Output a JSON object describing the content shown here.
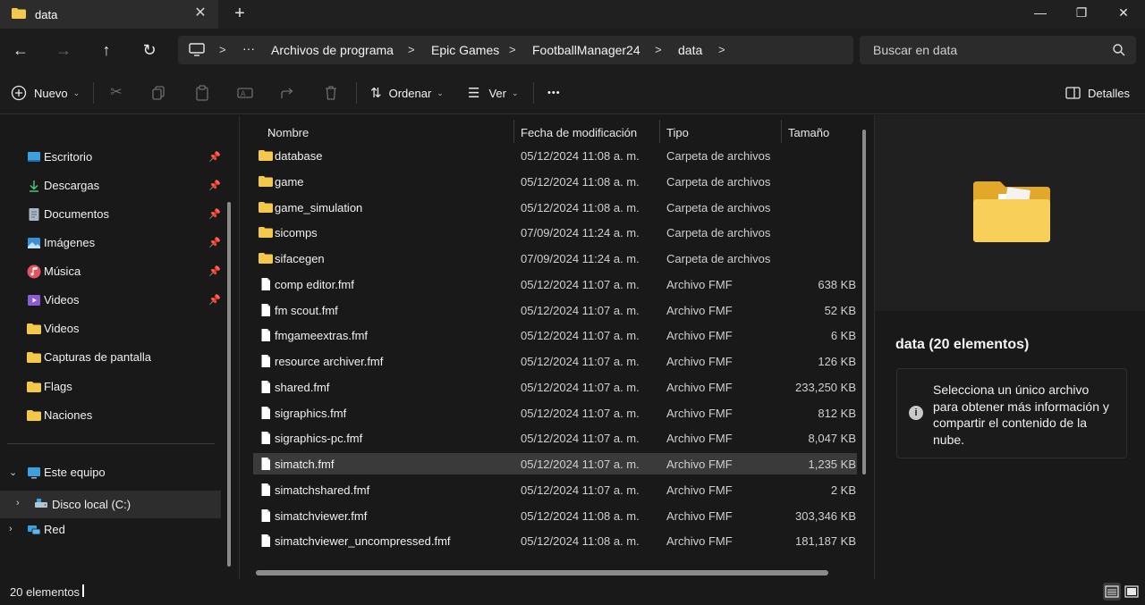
{
  "window": {
    "tab_title": "data",
    "icons": {
      "tab": "folder-icon",
      "close": "close-icon",
      "new_tab": "plus-icon"
    },
    "controls": {
      "minimize": "—",
      "maximize": "❐",
      "close": "✕"
    }
  },
  "navigation": {
    "back": "←",
    "forward": "→",
    "up": "↑",
    "refresh": "↻",
    "breadcrumb": [
      "Archivos de programa",
      "Epic Games",
      "FootballManager24",
      "data"
    ],
    "ellipsis": "···",
    "search_placeholder": "Buscar en data"
  },
  "toolbar": {
    "new_label": "Nuevo",
    "sort_label": "Ordenar",
    "view_label": "Ver",
    "more_label": "•••",
    "details_label": "Detalles",
    "icons": [
      "cut-icon",
      "copy-icon",
      "paste-icon",
      "rename-icon",
      "share-icon",
      "delete-icon"
    ]
  },
  "sidebar": {
    "quick_access": [
      {
        "label": "Escritorio",
        "icon": "desktop-icon",
        "pinned": true
      },
      {
        "label": "Descargas",
        "icon": "download-icon",
        "pinned": true
      },
      {
        "label": "Documentos",
        "icon": "documents-icon",
        "pinned": true
      },
      {
        "label": "Imágenes",
        "icon": "pictures-icon",
        "pinned": true
      },
      {
        "label": "Música",
        "icon": "music-icon",
        "pinned": true
      },
      {
        "label": "Videos",
        "icon": "videos-icon",
        "pinned": true
      },
      {
        "label": "Videos",
        "icon": "folder-icon",
        "pinned": false
      },
      {
        "label": "Capturas de pantalla",
        "icon": "folder-icon",
        "pinned": false
      },
      {
        "label": "Flags",
        "icon": "folder-icon",
        "pinned": false
      },
      {
        "label": "Naciones",
        "icon": "folder-icon",
        "pinned": false
      }
    ],
    "this_pc": "Este equipo",
    "local_disk": "Disco local (C:)",
    "network": "Red"
  },
  "file_list": {
    "columns": {
      "name": "Nombre",
      "date": "Fecha de modificación",
      "type": "Tipo",
      "size": "Tamaño"
    },
    "rows": [
      {
        "name": "database",
        "date": "05/12/2024 11:08 a. m.",
        "type": "Carpeta de archivos",
        "size": "",
        "kind": "folder"
      },
      {
        "name": "game",
        "date": "05/12/2024 11:08 a. m.",
        "type": "Carpeta de archivos",
        "size": "",
        "kind": "folder"
      },
      {
        "name": "game_simulation",
        "date": "05/12/2024 11:08 a. m.",
        "type": "Carpeta de archivos",
        "size": "",
        "kind": "folder"
      },
      {
        "name": "sicomps",
        "date": "07/09/2024 11:24 a. m.",
        "type": "Carpeta de archivos",
        "size": "",
        "kind": "folder"
      },
      {
        "name": "sifacegen",
        "date": "07/09/2024 11:24 a. m.",
        "type": "Carpeta de archivos",
        "size": "",
        "kind": "folder"
      },
      {
        "name": "comp editor.fmf",
        "date": "05/12/2024 11:07 a. m.",
        "type": "Archivo FMF",
        "size": "638 KB",
        "kind": "file"
      },
      {
        "name": "fm scout.fmf",
        "date": "05/12/2024 11:07 a. m.",
        "type": "Archivo FMF",
        "size": "52 KB",
        "kind": "file"
      },
      {
        "name": "fmgameextras.fmf",
        "date": "05/12/2024 11:07 a. m.",
        "type": "Archivo FMF",
        "size": "6 KB",
        "kind": "file"
      },
      {
        "name": "resource archiver.fmf",
        "date": "05/12/2024 11:07 a. m.",
        "type": "Archivo FMF",
        "size": "126 KB",
        "kind": "file"
      },
      {
        "name": "shared.fmf",
        "date": "05/12/2024 11:07 a. m.",
        "type": "Archivo FMF",
        "size": "233,250 KB",
        "kind": "file"
      },
      {
        "name": "sigraphics.fmf",
        "date": "05/12/2024 11:07 a. m.",
        "type": "Archivo FMF",
        "size": "812 KB",
        "kind": "file"
      },
      {
        "name": "sigraphics-pc.fmf",
        "date": "05/12/2024 11:07 a. m.",
        "type": "Archivo FMF",
        "size": "8,047 KB",
        "kind": "file"
      },
      {
        "name": "simatch.fmf",
        "date": "05/12/2024 11:07 a. m.",
        "type": "Archivo FMF",
        "size": "1,235 KB",
        "kind": "file",
        "selected": true
      },
      {
        "name": "simatchshared.fmf",
        "date": "05/12/2024 11:07 a. m.",
        "type": "Archivo FMF",
        "size": "2 KB",
        "kind": "file"
      },
      {
        "name": "simatchviewer.fmf",
        "date": "05/12/2024 11:08 a. m.",
        "type": "Archivo FMF",
        "size": "303,346 KB",
        "kind": "file"
      },
      {
        "name": "simatchviewer_uncompressed.fmf",
        "date": "05/12/2024 11:08 a. m.",
        "type": "Archivo FMF",
        "size": "181,187 KB",
        "kind": "file"
      }
    ]
  },
  "details_pane": {
    "title": "data (20 elementos)",
    "info_text": "Selecciona un único archivo para obtener más información y compartir el contenido de la nube."
  },
  "status_bar": {
    "item_count": "20 elementos"
  },
  "colors": {
    "background": "#191919",
    "folder": "#f4c84a",
    "selection": "#3a3a3a",
    "accent": "#4cc2ff"
  }
}
